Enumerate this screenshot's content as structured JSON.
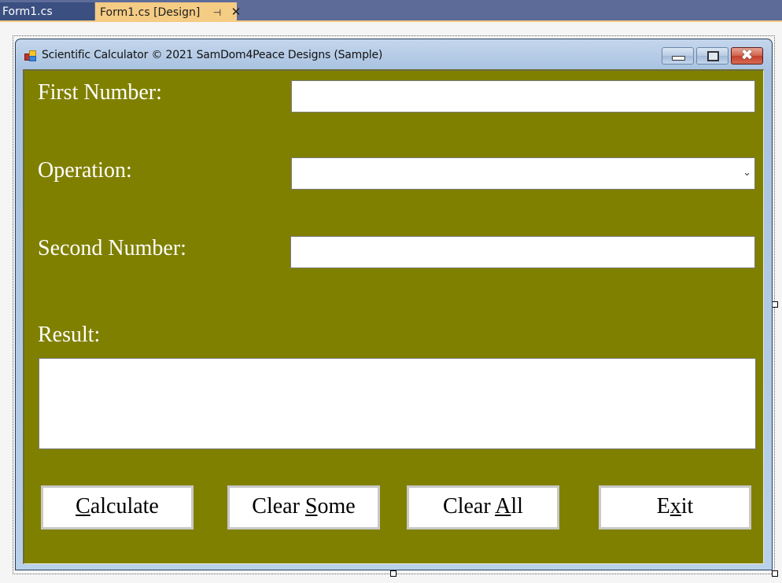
{
  "ide": {
    "tabs": [
      {
        "label": "Form1.cs",
        "active": false
      },
      {
        "label": "Form1.cs [Design]",
        "active": true,
        "pin_icon": "pin-icon",
        "close_icon": "close-icon"
      }
    ],
    "colors": {
      "tabstrip": "#5d6b99",
      "active_tab": "#f5cc84",
      "inactive_tab": "#3b4f81"
    }
  },
  "window": {
    "title": "Scientific Calculator © 2021 SamDom4Peace Designs (Sample)",
    "icon": "app-form-icon",
    "controls": {
      "minimize": "minimize-icon",
      "maximize": "maximize-icon",
      "close": "close-icon"
    },
    "close_glyph": "✖",
    "background_color": "#808000"
  },
  "form": {
    "first_number": {
      "label": "First Number:",
      "value": ""
    },
    "operation": {
      "label": "Operation:",
      "selected": "",
      "chevron": "⌄"
    },
    "second_number": {
      "label": "Second Number:",
      "value": ""
    },
    "result": {
      "label": "Result:",
      "value": ""
    }
  },
  "buttons": [
    {
      "pre": "",
      "mnemonic": "C",
      "post": "alculate"
    },
    {
      "pre": "Clear ",
      "mnemonic": "S",
      "post": "ome"
    },
    {
      "pre": "Clear ",
      "mnemonic": "A",
      "post": "ll"
    },
    {
      "pre": "E",
      "mnemonic": "x",
      "post": "it"
    }
  ]
}
